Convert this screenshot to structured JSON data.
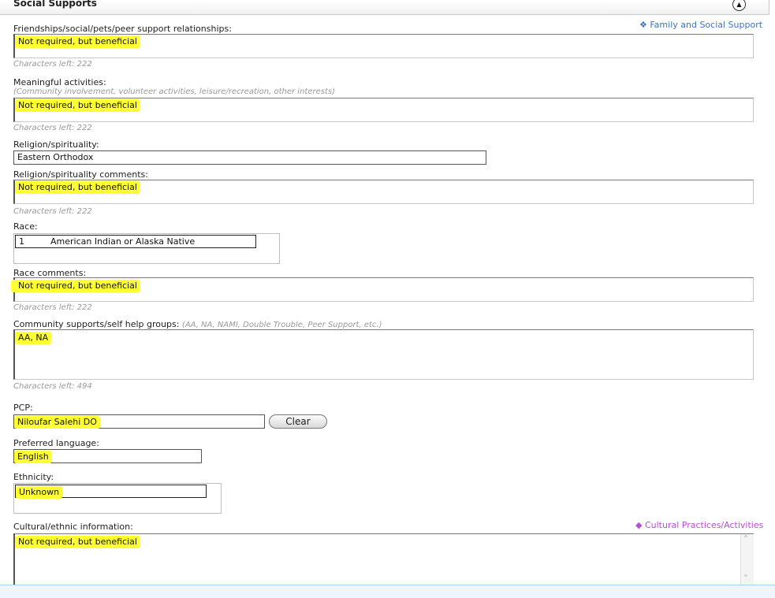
{
  "section": {
    "title": "Social Supports",
    "collapse_icon": "▲"
  },
  "links": {
    "family_social_support": "❖ Family and Social Support",
    "cultural_practices": "◆ Cultural Practices/Activities"
  },
  "fields": {
    "friendships": {
      "label": "Friendships/social/pets/peer support relationships:",
      "value": "Not required, but beneficial",
      "chars_left": "Characters left:  222"
    },
    "meaningful_activities": {
      "label": "Meaningful activities:",
      "hint": "(Community involvement, volunteer activities, leisure/recreation, other interests)",
      "value": "Not required, but beneficial",
      "chars_left": "Characters left:  222"
    },
    "religion": {
      "label": "Religion/spirituality:",
      "value": "Eastern Orthodox"
    },
    "religion_comments": {
      "label": "Religion/spirituality comments:",
      "value": "Not required, but beneficial",
      "chars_left": "Characters left:  222"
    },
    "race": {
      "label": "Race:",
      "rows": [
        {
          "code": "1",
          "name": "American Indian or Alaska Native"
        }
      ]
    },
    "race_comments": {
      "label": "Race comments:",
      "value": "Not required, but beneficial",
      "chars_left": "Characters left:  222"
    },
    "community_supports": {
      "label": "Community supports/self help groups:",
      "hint": "(AA, NA, NAMI, Double Trouble, Peer Support, etc.)",
      "value": "AA, NA",
      "chars_left": "Characters left:  494"
    },
    "pcp": {
      "label": "PCP:",
      "value": "Niloufar Salehi DO",
      "clear_label": "Clear"
    },
    "preferred_language": {
      "label": "Preferred language:",
      "value": "English"
    },
    "ethnicity": {
      "label": "Ethnicity:",
      "value": "Unknown"
    },
    "cultural_info": {
      "label": "Cultural/ethnic information:",
      "value": "Not required, but beneficial",
      "scroll_up": "˄",
      "scroll_down": "˅"
    }
  },
  "colors": {
    "highlight": "#ffff33",
    "link_blue": "#3a74c8",
    "link_purple": "#b44fd6"
  }
}
